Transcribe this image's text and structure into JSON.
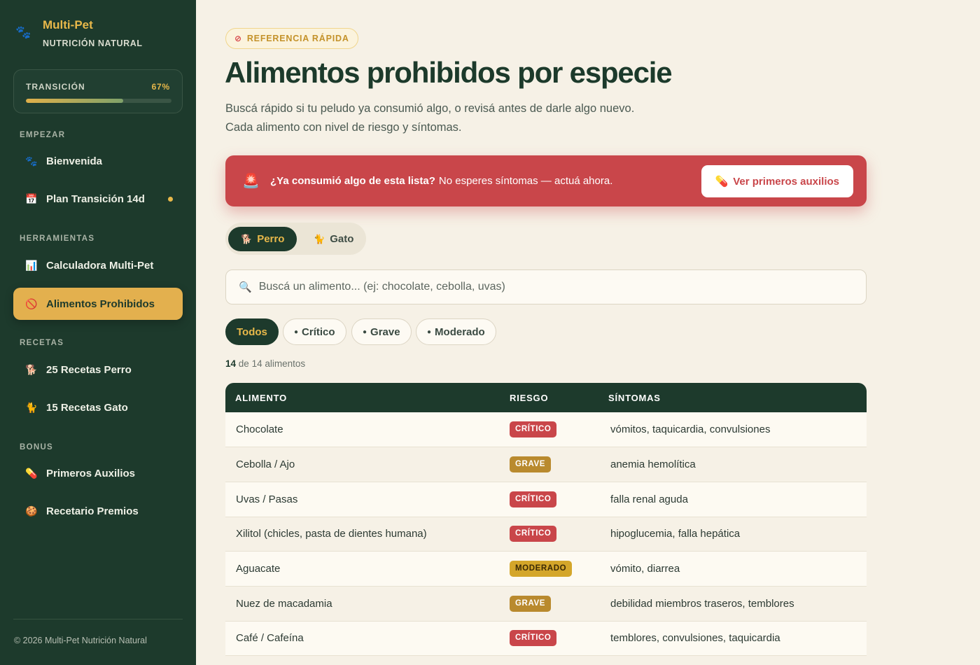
{
  "brand": {
    "name": "Multi-Pet",
    "tagline": "NUTRICIÓN NATURAL",
    "icon": "paw-icon"
  },
  "progress": {
    "label": "TRANSICIÓN",
    "percent_text": "67%",
    "value": 0.67,
    "colors": {
      "start": "#e0b04a",
      "end": "#7fa26a"
    }
  },
  "sidebar": {
    "sections": [
      {
        "label": "EMPEZAR",
        "items": [
          {
            "label": "Bienvenida",
            "icon": "paw-icon"
          },
          {
            "label": "Plan Transición 14d",
            "icon": "calendar-icon",
            "dot": true
          }
        ]
      },
      {
        "label": "HERRAMIENTAS",
        "items": [
          {
            "label": "Calculadora Multi-Pet",
            "icon": "bar-chart-icon"
          },
          {
            "label": "Alimentos Prohibidos",
            "icon": "prohibited-icon",
            "active": true
          }
        ]
      },
      {
        "label": "RECETAS",
        "items": [
          {
            "label": "25 Recetas Perro",
            "icon": "dog-icon"
          },
          {
            "label": "15 Recetas Gato",
            "icon": "cat-icon"
          }
        ]
      },
      {
        "label": "BONUS",
        "items": [
          {
            "label": "Primeros Auxilios",
            "icon": "pill-icon"
          },
          {
            "label": "Recetario Premios",
            "icon": "cookie-icon"
          }
        ]
      }
    ],
    "copyright": "© 2026 Multi-Pet Nutrición Natural"
  },
  "header": {
    "pill": "REFERENCIA RÁPIDA",
    "title": "Alimentos prohibidos por especie",
    "subtitle_line1": "Buscá rápido si tu peludo ya consumió algo, o revisá antes de darle algo nuevo.",
    "subtitle_line2": "Cada alimento con nivel de riesgo y síntomas."
  },
  "alert": {
    "strong": "¿Ya consumió algo de esta lista?",
    "text": "No esperes síntomas — actuá ahora.",
    "button": "Ver primeros auxilios",
    "color": "#c9464a"
  },
  "species": {
    "options": [
      "Perro",
      "Gato"
    ],
    "selected": "Perro"
  },
  "search": {
    "placeholder": "Buscá un alimento... (ej: chocolate, cebolla, uvas)",
    "value": ""
  },
  "filters": {
    "options": [
      "Todos",
      "Crítico",
      "Grave",
      "Moderado"
    ],
    "selected": "Todos"
  },
  "count": {
    "shown": "14",
    "text": "de 14 alimentos"
  },
  "table": {
    "headers": [
      "ALIMENTO",
      "RIESGO",
      "SÍNTOMAS"
    ],
    "rows": [
      {
        "food": "Chocolate",
        "risk": "CRÍTICO",
        "level": "critico",
        "symptoms": "vómitos, taquicardia, convulsiones"
      },
      {
        "food": "Cebolla / Ajo",
        "risk": "GRAVE",
        "level": "grave",
        "symptoms": "anemia hemolítica"
      },
      {
        "food": "Uvas / Pasas",
        "risk": "CRÍTICO",
        "level": "critico",
        "symptoms": "falla renal aguda"
      },
      {
        "food": "Xilitol (chicles, pasta de dientes humana)",
        "risk": "CRÍTICO",
        "level": "critico",
        "symptoms": "hipoglucemia, falla hepática"
      },
      {
        "food": "Aguacate",
        "risk": "MODERADO",
        "level": "moderado",
        "symptoms": "vómito, diarrea"
      },
      {
        "food": "Nuez de macadamia",
        "risk": "GRAVE",
        "level": "grave",
        "symptoms": "debilidad miembros traseros, temblores"
      },
      {
        "food": "Café / Cafeína",
        "risk": "CRÍTICO",
        "level": "critico",
        "symptoms": "temblores, convulsiones, taquicardia"
      }
    ]
  },
  "colors": {
    "sidebar_bg": "#1d3a2c",
    "accent": "#e8b84a",
    "critico": "#c9464a",
    "grave": "#b98a2e",
    "moderado": "#d4a62a"
  }
}
